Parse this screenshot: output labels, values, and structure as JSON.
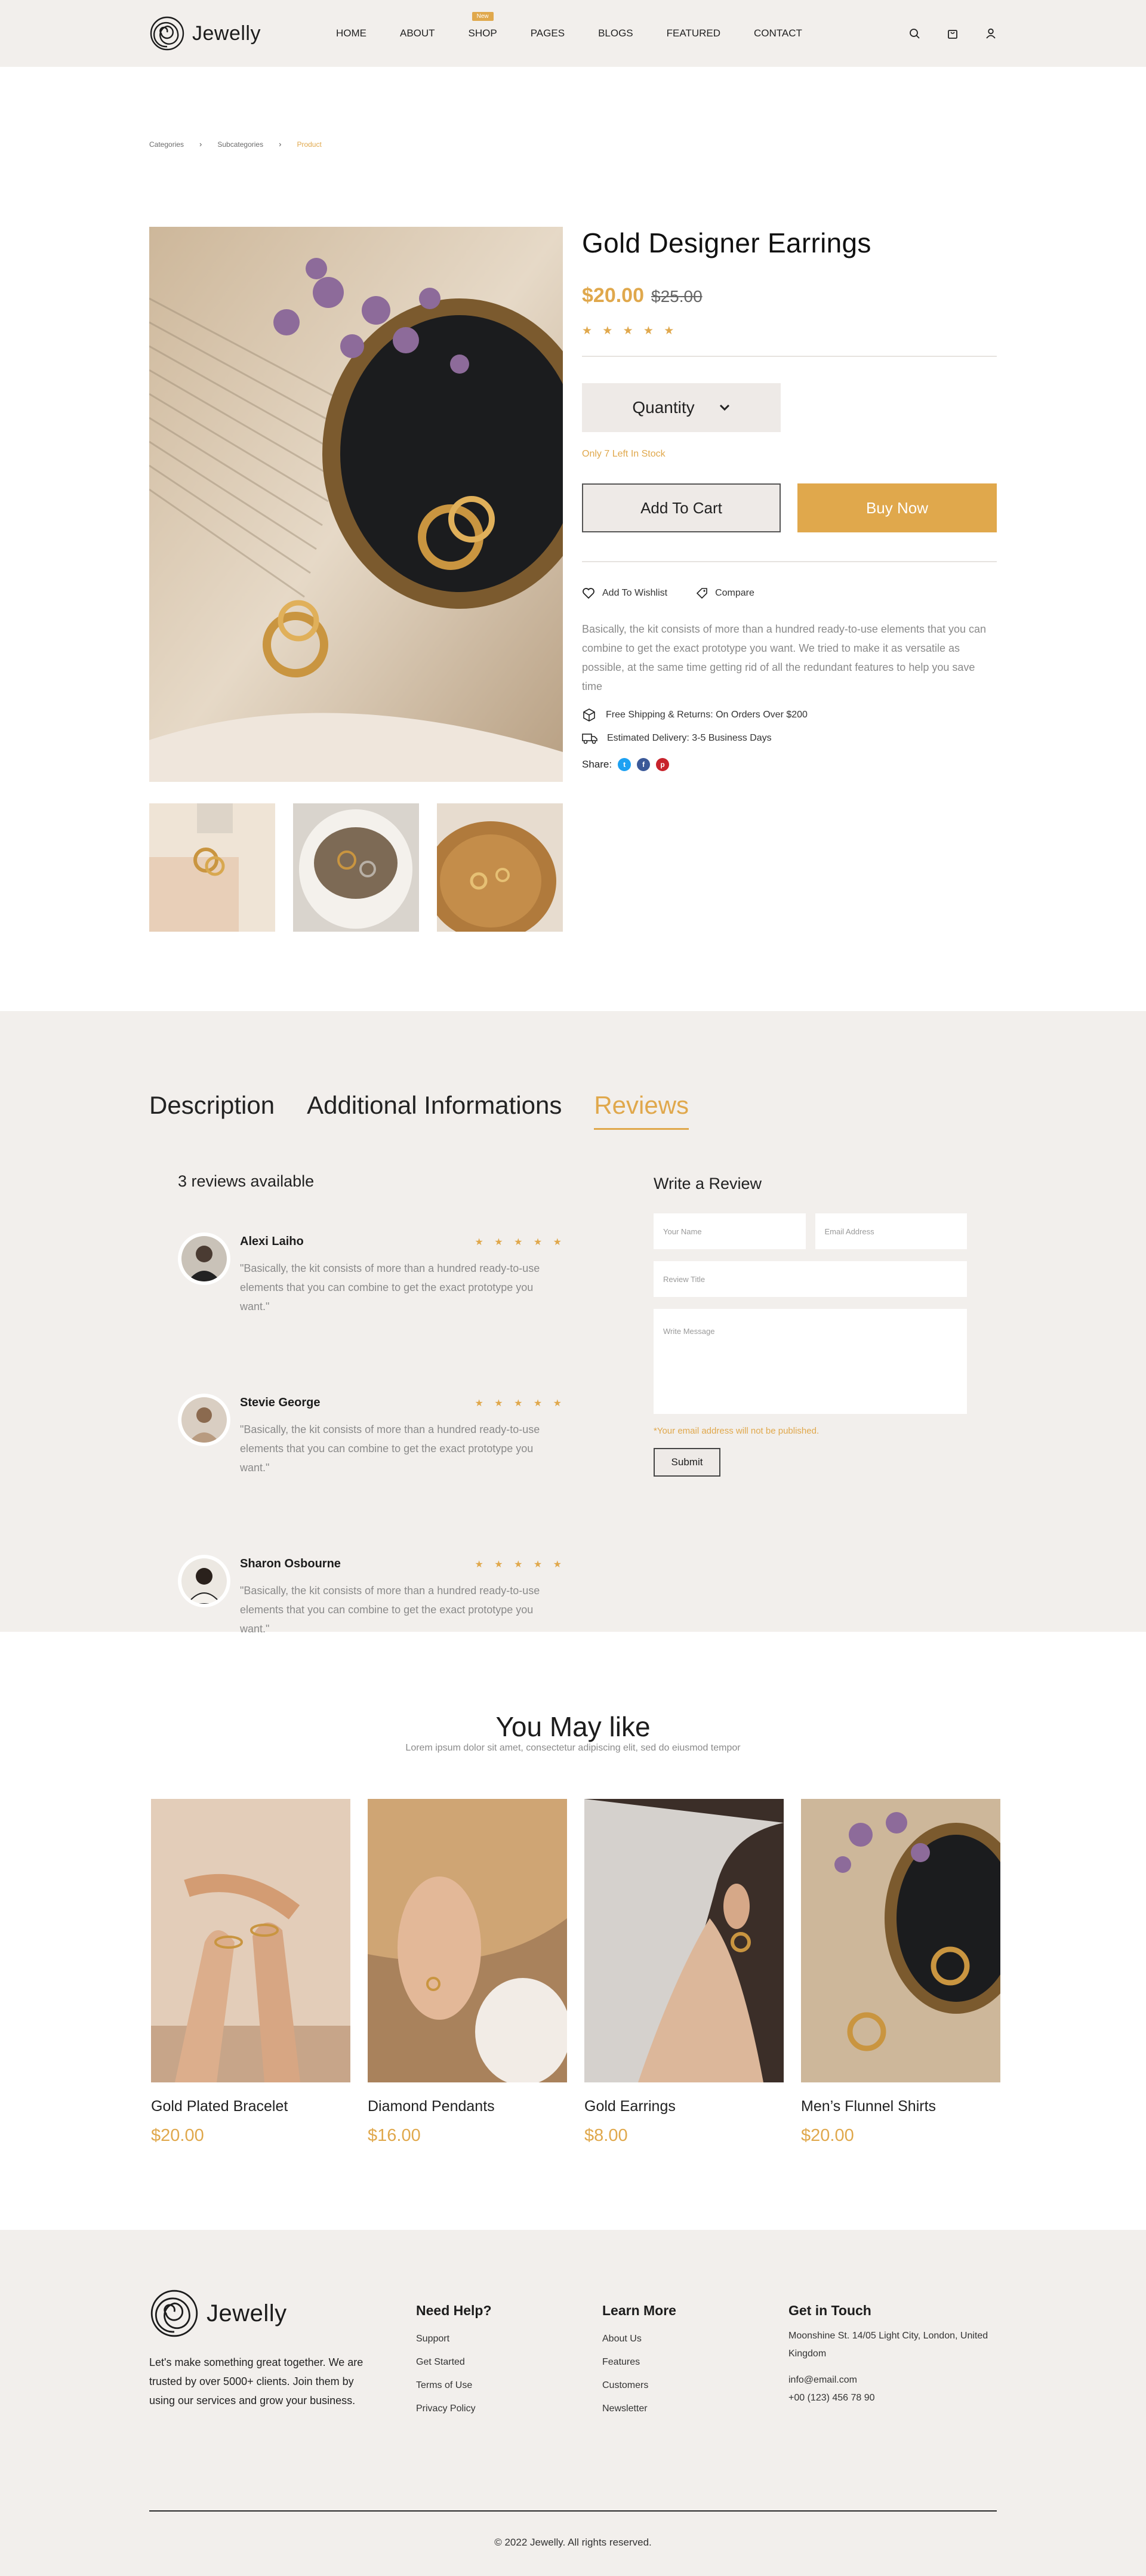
{
  "brand": {
    "name": "Jewelly"
  },
  "nav": {
    "items": [
      {
        "label": "HOME"
      },
      {
        "label": "ABOUT"
      },
      {
        "label": "SHOP",
        "badge": "New"
      },
      {
        "label": "PAGES"
      },
      {
        "label": "BLOGS"
      },
      {
        "label": "FEATURED"
      },
      {
        "label": "CONTACT"
      }
    ],
    "icons": [
      "search-icon",
      "bag-icon",
      "user-icon"
    ]
  },
  "breadcrumb": [
    "Categories",
    "Subcategories",
    "Product"
  ],
  "product": {
    "title": "Gold Designer Earrings",
    "price": "$20.00",
    "old_price": "$25.00",
    "rating": 5,
    "stars": "★ ★ ★ ★ ★",
    "quantity_label": "Quantity",
    "stock_text": "Only 7 Left In Stock",
    "add_to_cart": "Add To Cart",
    "buy_now": "Buy Now",
    "wishlist": "Add To Wishlist",
    "compare": "Compare",
    "description": "Basically, the kit consists of more than a hundred ready-to-use elements that you can combine to get the exact prototype you want. We tried to make it as versatile as possible, at the same time getting rid of all the redundant features to help you save time",
    "shipping": "Free Shipping & Returns: On Orders Over $200",
    "delivery": "Estimated Delivery: 3-5 Business Days",
    "share_label": "Share:",
    "share_icons": [
      "twitter-icon",
      "facebook-icon",
      "pinterest-icon"
    ]
  },
  "tabs": [
    {
      "label": "Description"
    },
    {
      "label": "Additional Informations"
    },
    {
      "label": "Reviews",
      "active": true
    }
  ],
  "reviews": {
    "count_label": "3 reviews available",
    "items": [
      {
        "name": "Alexi Laiho",
        "stars": "★ ★ ★ ★ ★",
        "text": "\"Basically, the kit consists of more than a hundred ready-to-use elements that you can combine to get the exact prototype you want.\""
      },
      {
        "name": "Stevie George",
        "stars": "★ ★ ★ ★ ★",
        "text": "\"Basically, the kit consists of more than a hundred ready-to-use elements that you can combine to get the exact prototype you want.\""
      },
      {
        "name": "Sharon Osbourne",
        "stars": "★ ★ ★ ★ ★",
        "text": "\"Basically, the kit consists of more than a hundred ready-to-use elements that you can combine to get the exact prototype you want.\""
      }
    ]
  },
  "review_form": {
    "title": "Write a Review",
    "name_placeholder": "Your Name",
    "email_placeholder": "Email Address",
    "title_placeholder": "Review Title",
    "message_placeholder": "Write Message",
    "note": "*Your email address will not be published.",
    "submit": "Submit"
  },
  "may_like": {
    "title": "You May like",
    "subtitle": "Lorem ipsum dolor sit amet, consectetur adipiscing elit, sed do eiusmod tempor",
    "items": [
      {
        "name": "Gold Plated Bracelet",
        "price": "$20.00"
      },
      {
        "name": "Diamond Pendants",
        "price": "$16.00"
      },
      {
        "name": "Gold Earrings",
        "price": "$8.00"
      },
      {
        "name": "Men’s Flunnel Shirts",
        "price": "$20.00"
      }
    ]
  },
  "footer": {
    "about": "Let's make something great together. We are trusted by over 5000+ clients. Join them by using our services and grow your business.",
    "help": {
      "title": "Need Help?",
      "links": [
        "Support",
        "Get Started",
        "Terms of Use",
        "Privacy Policy"
      ]
    },
    "learn": {
      "title": "Learn More",
      "links": [
        "About Us",
        "Features",
        "Customers",
        "Newsletter"
      ]
    },
    "contact": {
      "title": "Get in Touch",
      "address": "Moonshine St. 14/05 Light City, London, United Kingdom",
      "email": "info@email.com",
      "phone": "+00 (123) 456 78 90"
    },
    "copyright": "© 2022 Jewelly. All rights reserved."
  },
  "colors": {
    "accent": "#e0a84c",
    "section_bg": "#f2efec",
    "text": "#1c1c1c",
    "muted": "#8a8a8a"
  }
}
